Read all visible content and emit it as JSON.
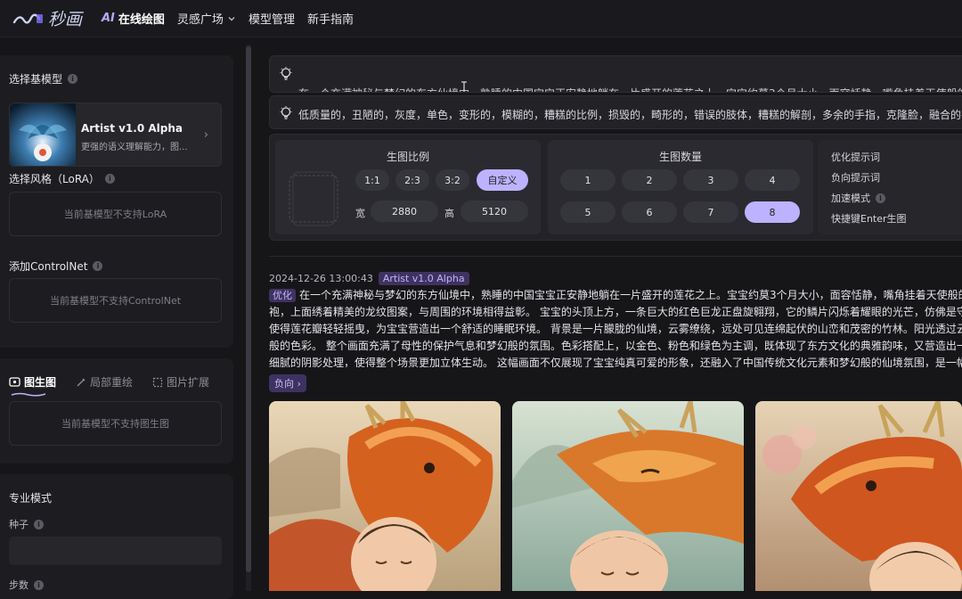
{
  "app": {
    "logo_text": "秒画"
  },
  "nav": {
    "ai_label": "AI",
    "online_draw": "在线绘图",
    "inspiration": "灵感广场",
    "model_mgmt": "模型管理",
    "guide": "新手指南"
  },
  "sidebar": {
    "base_model_title": "选择基模型",
    "model": {
      "name": "Artist v1.0 Alpha",
      "desc": "更强的语义理解能力，图..."
    },
    "lora_title": "选择风格（LoRA）",
    "lora_empty": "当前基模型不支持LoRA",
    "controlnet_title": "添加ControlNet",
    "controlnet_empty": "当前基模型不支持ControlNet",
    "tabs": [
      {
        "label": "图生图"
      },
      {
        "label": "局部重绘"
      },
      {
        "label": "图片扩展"
      }
    ],
    "img2img_empty": "当前基模型不支持图生图",
    "pro_mode": "专业模式",
    "seed_label": "种子",
    "steps_label": "步数"
  },
  "prompt": {
    "positive": "在一个充满神秘与梦幻的东方仙境中，熟睡的中国宝宝正安静地躺在一片盛开的莲花之上。宝宝约莫3个月大小，面容恬静，嘴角挂着天使般的微笑",
    "negative": "低质量的，丑陋的，灰度，单色，变形的，模糊的，糟糕的比例，损毁的，畸形的，错误的肢体，糟糕的解剖，多余的手指，克隆脸，融合的手指"
  },
  "ratio": {
    "title": "生图比例",
    "options": [
      "1:1",
      "2:3",
      "3:2",
      "自定义"
    ],
    "selected": "自定义",
    "width_label": "宽",
    "width": "2880",
    "height_label": "高",
    "height": "5120"
  },
  "count": {
    "title": "生图数量",
    "options": [
      "1",
      "2",
      "3",
      "4",
      "5",
      "6",
      "7",
      "8"
    ],
    "selected": "8"
  },
  "options": {
    "optimize": "优化提示词",
    "negative": "负向提示词",
    "accelerate": "加速模式",
    "shortcut": "快捷键Enter生图"
  },
  "result": {
    "timestamp": "2024-12-26 13:00:43",
    "model_badge": "Artist v1.0 Alpha",
    "optimize_badge": "优化",
    "lines": [
      "在一个充满神秘与梦幻的东方仙境中，熟睡的中国宝宝正安静地躺在一片盛开的莲花之上。宝宝约莫3个月大小，面容恬静，嘴角挂着天使般的微笑",
      "袍，上面绣着精美的龙纹图案，与周围的环境相得益彰。 宝宝的头顶上方，一条巨大的红色巨龙正盘旋翱翔，它的鳞片闪烁着耀眼的光芒，仿佛是守护神",
      "使得莲花瓣轻轻摇曳，为宝宝营造出一个舒适的睡眠环境。 背景是一片朦胧的仙境，云雾缭绕，远处可见连绵起伏的山峦和茂密的竹林。阳光透过云层洒",
      "般的色彩。 整个画面充满了母性的保护气息和梦幻般的氛围。色彩搭配上，以金色、粉色和绿色为主调，既体现了东方文化的典雅韵味，又营造出一种温",
      "细腻的阴影处理，使得整个场景更加立体生动。 这幅画面不仅展现了宝宝纯真可爱的形象，还融入了中国传统文化元素和梦幻般的仙境氛围，是一幅充满"
    ],
    "negative_btn": "负向 ›"
  },
  "colors": {
    "accent": "#bcb2ff",
    "bg": "#161619",
    "panel": "#1d1d21"
  }
}
